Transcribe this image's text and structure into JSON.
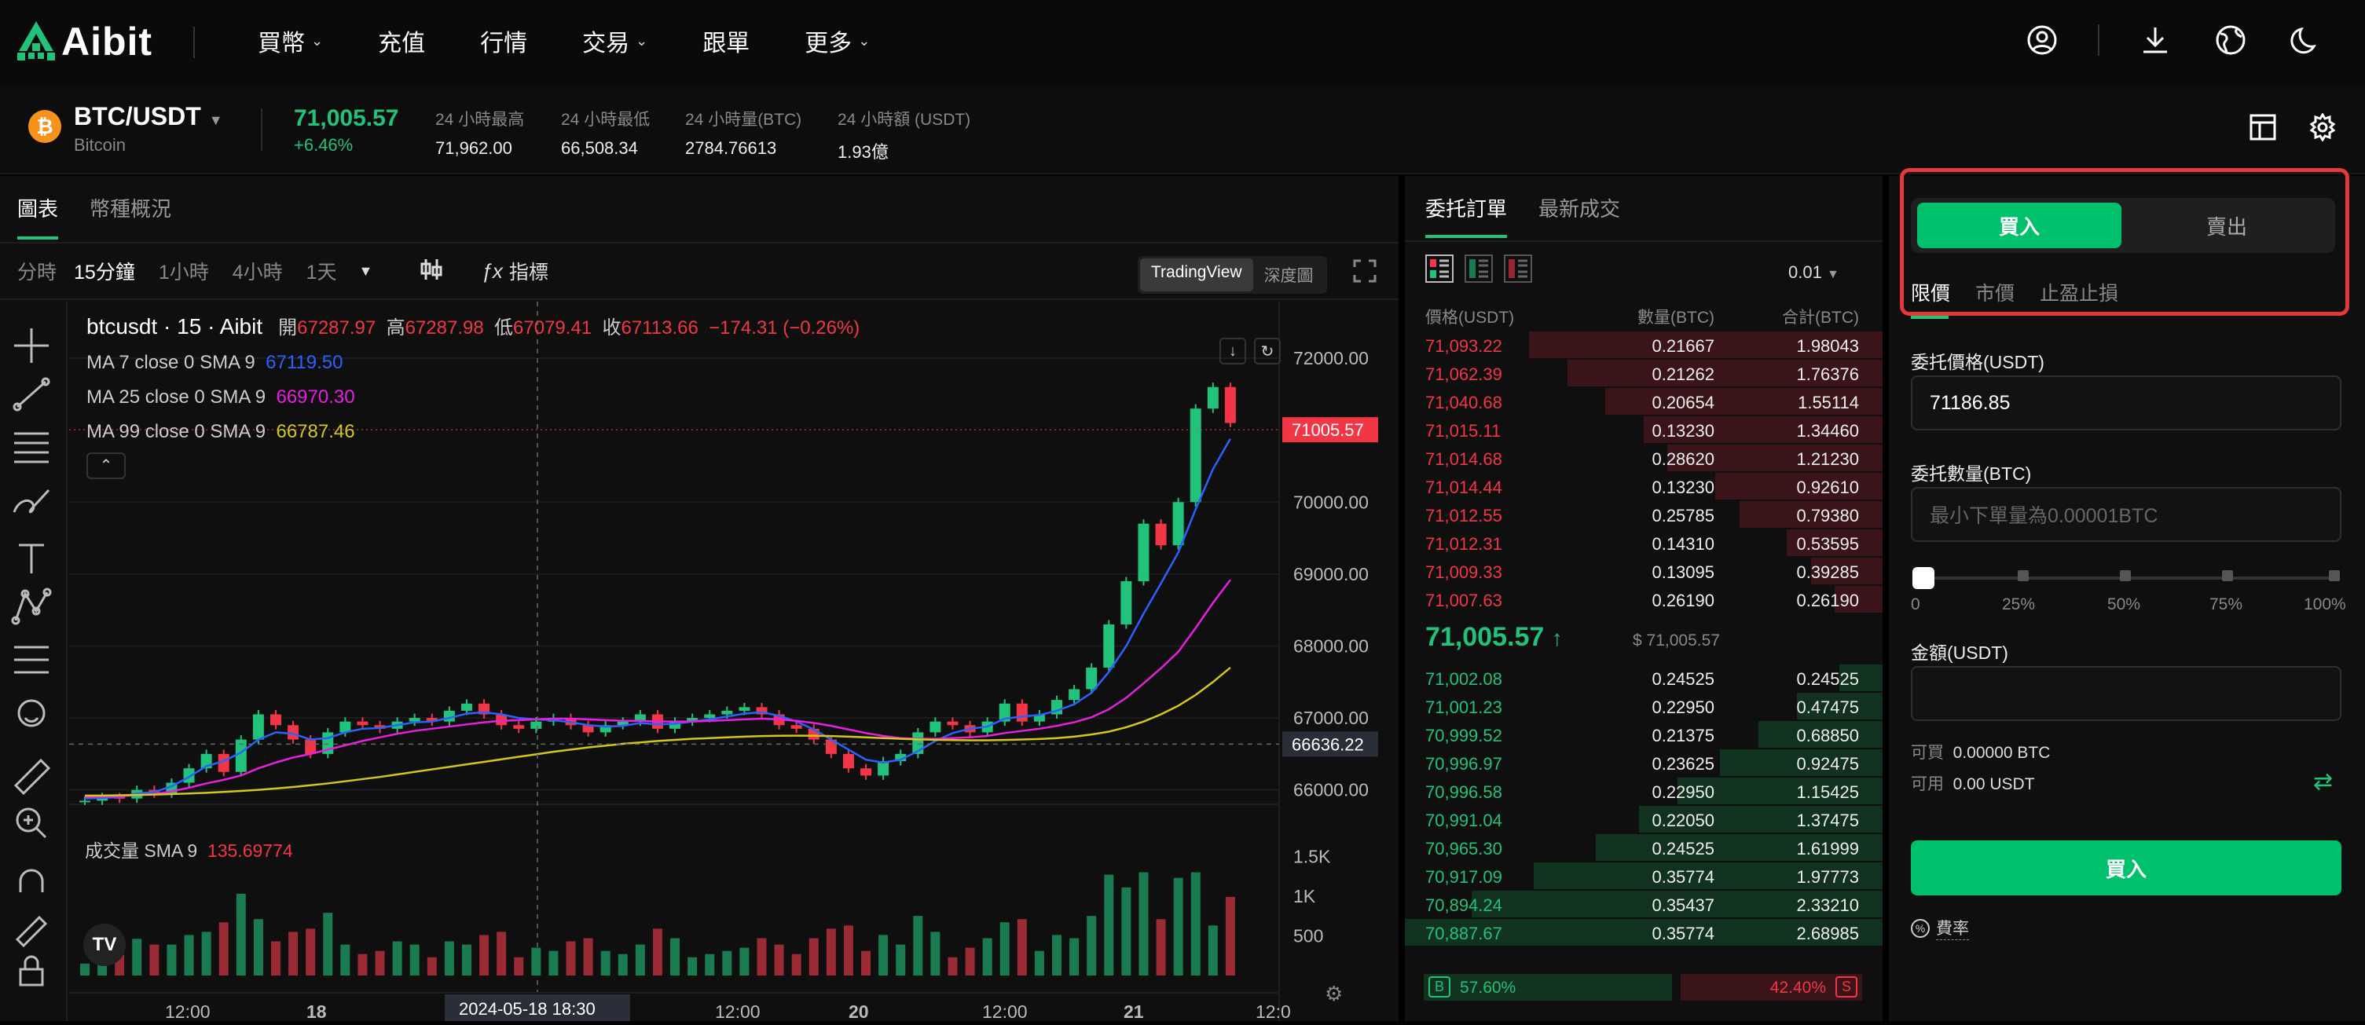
{
  "brand": {
    "name": "Aibit",
    "color": "#21c279"
  },
  "nav": {
    "items": [
      {
        "label": "買幣",
        "dropdown": true
      },
      {
        "label": "充值",
        "dropdown": false
      },
      {
        "label": "行情",
        "dropdown": false
      },
      {
        "label": "交易",
        "dropdown": true
      },
      {
        "label": "跟單",
        "dropdown": false
      },
      {
        "label": "更多",
        "dropdown": true
      }
    ],
    "right_icons": [
      "user-icon",
      "download-icon",
      "globe-icon",
      "moon-icon"
    ]
  },
  "ticker": {
    "coin_icon": "₿",
    "pair": "BTC/USDT",
    "pair_name": "Bitcoin",
    "last_price": "71,005.57",
    "change": "+6.46%",
    "stats": [
      {
        "label": "24 小時最高",
        "value": "71,962.00"
      },
      {
        "label": "24 小時最低",
        "value": "66,508.34"
      },
      {
        "label": "24 小時量(BTC)",
        "value": "2784.76613"
      },
      {
        "label": "24 小時額 (USDT)",
        "value": "1.93億"
      }
    ]
  },
  "chart_panel": {
    "tabs": [
      "圖表",
      "幣種概況"
    ],
    "timeframes": [
      "分時",
      "15分鐘",
      "1小時",
      "4小時",
      "1天"
    ],
    "active_timeframe": "15分鐘",
    "indicator_label": "指標",
    "views": [
      "TradingView",
      "深度圖"
    ],
    "active_view": "TradingView"
  },
  "chart_data": {
    "type": "line",
    "symbol_line": "btcusdt · 15 · Aibit",
    "ohlc": {
      "open_label": "開",
      "open": "67287.97",
      "high_label": "高",
      "high": "67287.98",
      "low_label": "低",
      "low": "67079.41",
      "close_label": "收",
      "close": "67113.66",
      "change": "−174.31 (−0.26%)"
    },
    "ma": [
      {
        "label": "MA 7 close 0 SMA 9",
        "value": "67119.50",
        "color": "#2962ff"
      },
      {
        "label": "MA 25 close 0 SMA 9",
        "value": "66970.30",
        "color": "#e91ee0"
      },
      {
        "label": "MA 99 close 0 SMA 9",
        "value": "66787.46",
        "color": "#d4c61a"
      }
    ],
    "y_ticks": [
      72000,
      70000,
      69000,
      68000,
      67000,
      66000
    ],
    "y_tick_labels": [
      "72000.00",
      "70000.00",
      "69000.00",
      "68000.00",
      "67000.00",
      "66000.00"
    ],
    "ylim": [
      65800,
      72350
    ],
    "price_tag": {
      "value": 71005.57,
      "label": "71005.57",
      "color": "#f23645"
    },
    "cross_tag": {
      "value": 66636.22,
      "label": "66636.22"
    },
    "x_ticks": [
      "12:00",
      "18",
      "12:00",
      "20",
      "12:00",
      "21",
      "12:0"
    ],
    "cursor_time": "2024-05-18   18:30",
    "series": [
      {
        "name": "close",
        "values": [
          65850,
          65900,
          65880,
          66000,
          65950,
          66100,
          66300,
          66500,
          66250,
          66700,
          67050,
          66900,
          66700,
          66500,
          66800,
          66950,
          66900,
          66850,
          66950,
          67000,
          66950,
          67100,
          67200,
          67050,
          66900,
          66850,
          66950,
          67000,
          66900,
          66800,
          66900,
          66950,
          67050,
          66850,
          66950,
          67000,
          67050,
          67100,
          67150,
          67050,
          66900,
          66850,
          66700,
          66500,
          66300,
          66200,
          66400,
          66500,
          66800,
          66950,
          66900,
          66800,
          66950,
          67200,
          66950,
          67050,
          67250,
          67400,
          67700,
          68300,
          68900,
          69700,
          69400,
          70000,
          71300,
          71600,
          71100
        ]
      },
      {
        "name": "MA 7",
        "values": [
          65880,
          65890,
          65900,
          65950,
          65970,
          66050,
          66180,
          66330,
          66400,
          66520,
          66700,
          66800,
          66780,
          66700,
          66720,
          66800,
          66850,
          66860,
          66900,
          66940,
          66950,
          67000,
          67060,
          67080,
          67050,
          67000,
          66980,
          66970,
          66940,
          66900,
          66880,
          66890,
          66930,
          66910,
          66920,
          66950,
          66980,
          67020,
          67060,
          67080,
          67030,
          66950,
          66840,
          66700,
          66560,
          66420,
          66380,
          66420,
          66540,
          66680,
          66790,
          66850,
          66880,
          66990,
          67020,
          67040,
          67100,
          67190,
          67350,
          67640,
          68000,
          68450,
          68870,
          69300,
          69900,
          70460,
          70880
        ]
      },
      {
        "name": "MA 25",
        "values": [
          65900,
          65905,
          65910,
          65930,
          65940,
          65980,
          66030,
          66090,
          66140,
          66200,
          66300,
          66380,
          66450,
          66500,
          66560,
          66620,
          66680,
          66730,
          66780,
          66820,
          66850,
          66880,
          66910,
          66940,
          66960,
          66970,
          66980,
          66990,
          66990,
          66980,
          66970,
          66960,
          66960,
          66950,
          66950,
          66950,
          66960,
          66970,
          66980,
          66990,
          66980,
          66960,
          66930,
          66890,
          66840,
          66790,
          66750,
          66720,
          66710,
          66710,
          66720,
          66730,
          66750,
          66790,
          66820,
          66850,
          66890,
          66940,
          67010,
          67120,
          67280,
          67480,
          67690,
          67920,
          68250,
          68600,
          68920
        ]
      },
      {
        "name": "MA 99",
        "values": [
          65920,
          65922,
          65925,
          65930,
          65935,
          65942,
          65950,
          65960,
          65972,
          65985,
          66000,
          66020,
          66040,
          66065,
          66090,
          66120,
          66150,
          66180,
          66215,
          66250,
          66285,
          66320,
          66355,
          66390,
          66425,
          66460,
          66495,
          66530,
          66560,
          66590,
          66615,
          66640,
          66660,
          66680,
          66695,
          66710,
          66720,
          66730,
          66740,
          66748,
          66752,
          66754,
          66752,
          66748,
          66740,
          66730,
          66720,
          66710,
          66702,
          66696,
          66692,
          66690,
          66690,
          66694,
          66700,
          66708,
          66720,
          66740,
          66770,
          66810,
          66870,
          66950,
          67050,
          67170,
          67320,
          67500,
          67700
        ]
      }
    ],
    "volume": {
      "label": "成交量 SMA 9",
      "value": "135.69774",
      "y_tick_labels": [
        "1.5K",
        "1K",
        "500"
      ],
      "y_ticks": [
        1500,
        1000,
        500
      ],
      "ylim": [
        0,
        1800
      ]
    }
  },
  "orderbook": {
    "tabs": [
      "委托訂單",
      "最新成交"
    ],
    "precision": "0.01",
    "headers": [
      "價格(USDT)",
      "數量(BTC)",
      "合計(BTC)"
    ],
    "asks": [
      {
        "price": "71,093.22",
        "qty": "0.21667",
        "total": "1.98043",
        "depth": 0.74
      },
      {
        "price": "71,062.39",
        "qty": "0.21262",
        "total": "1.76376",
        "depth": 0.66
      },
      {
        "price": "71,040.68",
        "qty": "0.20654",
        "total": "1.55114",
        "depth": 0.58
      },
      {
        "price": "71,015.11",
        "qty": "0.13230",
        "total": "1.34460",
        "depth": 0.5
      },
      {
        "price": "71,014.68",
        "qty": "0.28620",
        "total": "1.21230",
        "depth": 0.45
      },
      {
        "price": "71,014.44",
        "qty": "0.13230",
        "total": "0.92610",
        "depth": 0.35
      },
      {
        "price": "71,012.55",
        "qty": "0.25785",
        "total": "0.79380",
        "depth": 0.3
      },
      {
        "price": "71,012.31",
        "qty": "0.14310",
        "total": "0.53595",
        "depth": 0.2
      },
      {
        "price": "71,009.33",
        "qty": "0.13095",
        "total": "0.39285",
        "depth": 0.15
      },
      {
        "price": "71,007.63",
        "qty": "0.26190",
        "total": "0.26190",
        "depth": 0.1
      }
    ],
    "mid_price": "71,005.57",
    "mid_fiat": "$ 71,005.57",
    "bids": [
      {
        "price": "71,002.08",
        "qty": "0.24525",
        "total": "0.24525",
        "depth": 0.09
      },
      {
        "price": "71,001.23",
        "qty": "0.22950",
        "total": "0.47475",
        "depth": 0.18
      },
      {
        "price": "70,999.52",
        "qty": "0.21375",
        "total": "0.68850",
        "depth": 0.26
      },
      {
        "price": "70,996.97",
        "qty": "0.23625",
        "total": "0.92475",
        "depth": 0.34
      },
      {
        "price": "70,996.58",
        "qty": "0.22950",
        "total": "1.15425",
        "depth": 0.43
      },
      {
        "price": "70,991.04",
        "qty": "0.22050",
        "total": "1.37475",
        "depth": 0.51
      },
      {
        "price": "70,965.30",
        "qty": "0.24525",
        "total": "1.61999",
        "depth": 0.6
      },
      {
        "price": "70,917.09",
        "qty": "0.35774",
        "total": "1.97773",
        "depth": 0.73
      },
      {
        "price": "70,894.24",
        "qty": "0.35437",
        "total": "2.33210",
        "depth": 0.86
      },
      {
        "price": "70,887.67",
        "qty": "0.35774",
        "total": "2.68985",
        "depth": 1.0
      }
    ],
    "buy_ratio_label": "B",
    "buy_ratio": "57.60%",
    "buy_ratio_value": 0.576,
    "sell_ratio": "42.40%",
    "sell_ratio_label": "S"
  },
  "trade": {
    "buy_tab": "買入",
    "sell_tab": "賣出",
    "order_types": [
      "限價",
      "市價",
      "止盈止損"
    ],
    "active_order_type": "限價",
    "price_label": "委托價格(USDT)",
    "price_value": "71186.85",
    "qty_label": "委托數量(BTC)",
    "qty_placeholder": "最小下單量為0.00001BTC",
    "percent_marks": [
      "0",
      "25%",
      "50%",
      "75%",
      "100%"
    ],
    "amount_label": "金額(USDT)",
    "avail_buy_label": "可買",
    "avail_buy_value": "0.00000 BTC",
    "avail_label": "可用",
    "avail_value": "0.00 USDT",
    "submit": "買入",
    "fee_label": "費率"
  },
  "colors": {
    "up": "#21c279",
    "down": "#f23645",
    "accent": "#00c06b"
  }
}
